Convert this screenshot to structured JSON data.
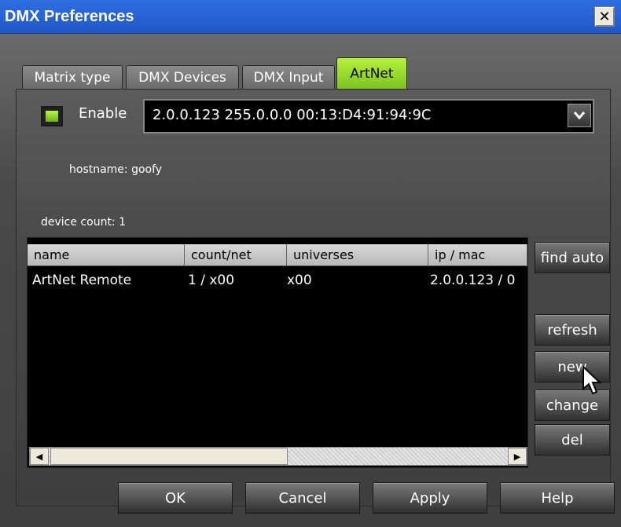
{
  "window": {
    "title": "DMX Preferences",
    "close_glyph": "✕"
  },
  "tabs": [
    {
      "label": "Matrix type",
      "active": false
    },
    {
      "label": "DMX Devices",
      "active": false
    },
    {
      "label": "DMX Input",
      "active": false
    },
    {
      "label": "ArtNet",
      "active": true
    }
  ],
  "artnet": {
    "enable_label": "Enable",
    "enabled": true,
    "interface_value": "2.0.0.123   255.0.0.0   00:13:D4:91:94:9C",
    "hostname": "hostname: goofy",
    "device_count": "device count: 1"
  },
  "table": {
    "headers": [
      "name",
      "count/net",
      "universes",
      "ip / mac"
    ],
    "rows": [
      [
        "ArtNet Remote",
        "1 / x00",
        "x00",
        "2.0.0.123 / 0"
      ]
    ]
  },
  "side_buttons": {
    "find_auto": "find auto",
    "refresh": "refresh",
    "new": "new",
    "change": "change",
    "del": "del"
  },
  "footer": {
    "ok": "OK",
    "cancel": "Cancel",
    "apply": "Apply",
    "help": "Help"
  },
  "colors": {
    "accent": "#8fd62a",
    "title_bar": "#2a63d6",
    "panel": "#4a4a4a"
  },
  "icons": [
    "close-icon",
    "dropdown-arrow-icon",
    "scroll-left-icon",
    "scroll-right-icon",
    "mouse-pointer-icon"
  ]
}
